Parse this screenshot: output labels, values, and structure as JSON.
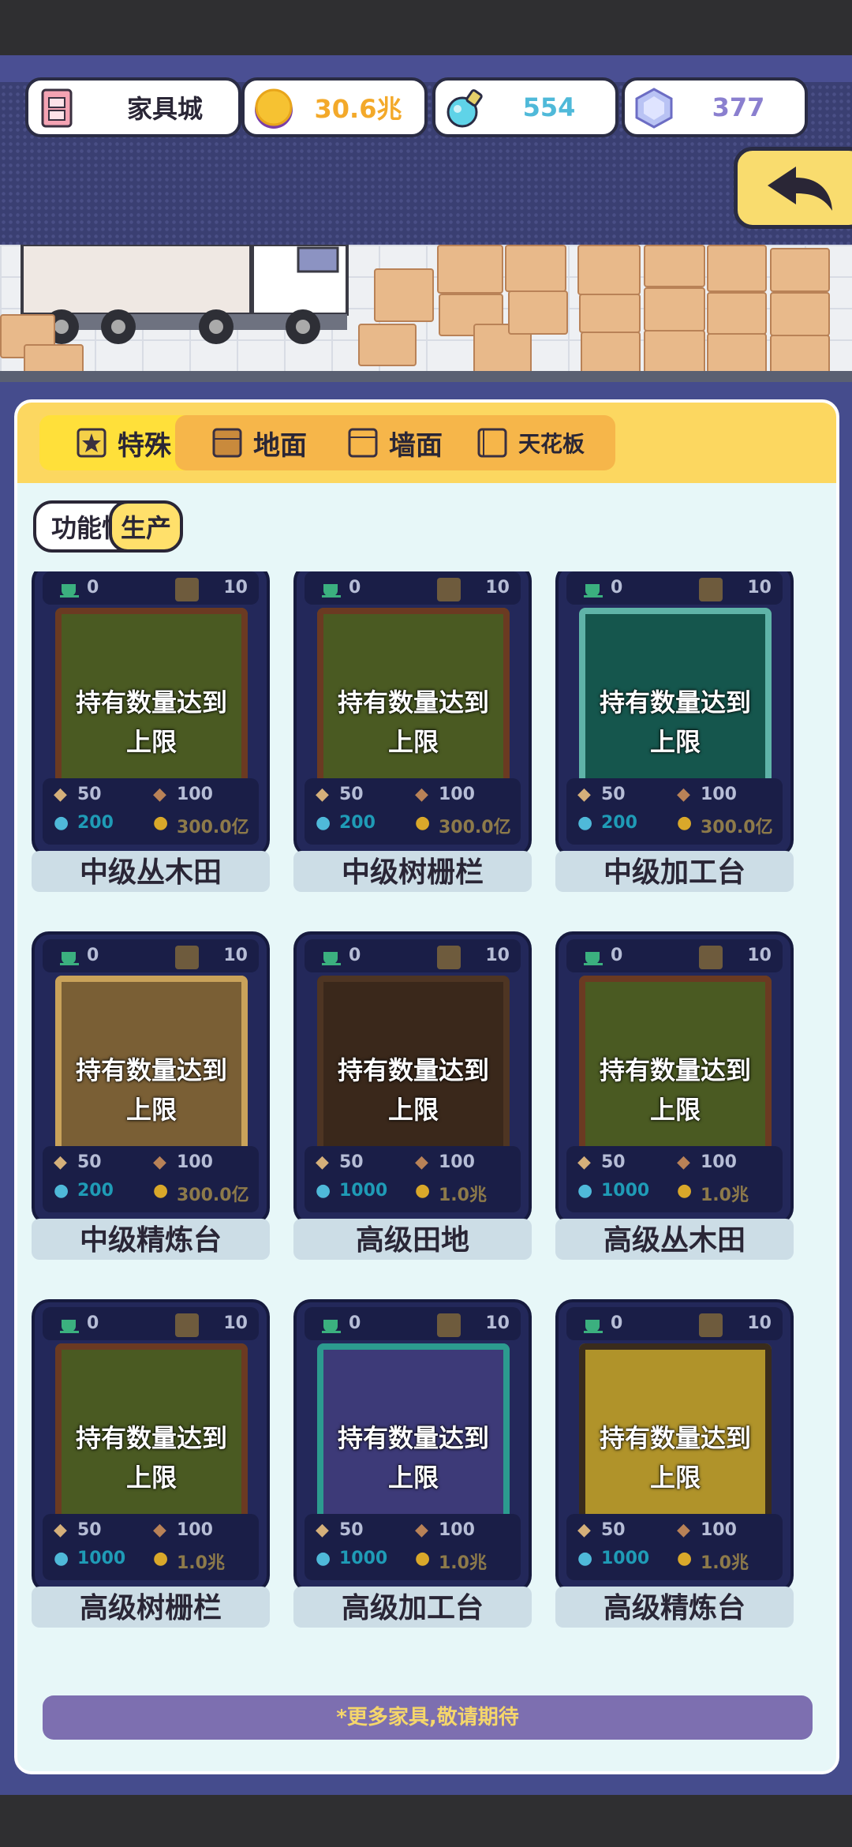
{
  "hud": {
    "location": "家具城",
    "coins": "30.6兆",
    "potion": "554",
    "gems": "377"
  },
  "tabs": [
    {
      "label": "特殊",
      "active": true
    },
    {
      "label": "地面",
      "active": false
    },
    {
      "label": "墙面",
      "active": false
    },
    {
      "label": "天花板",
      "active": false
    }
  ],
  "subtabs": [
    {
      "label": "功能性",
      "active": false
    },
    {
      "label": "生产",
      "active": true
    }
  ],
  "cards": [
    {
      "name": "中级丛木田",
      "owned": "0",
      "max": "10",
      "status": "持有数量达到上限",
      "status1": "持有数量达到",
      "status2": "上限",
      "res1": "50",
      "res2": "100",
      "potion": "200",
      "coin": "300.0亿",
      "theme": "field"
    },
    {
      "name": "中级树栅栏",
      "owned": "0",
      "max": "10",
      "status": "持有数量达到上限",
      "status1": "持有数量达到",
      "status2": "上限",
      "res1": "50",
      "res2": "100",
      "potion": "200",
      "coin": "300.0亿",
      "theme": "field"
    },
    {
      "name": "中级加工台",
      "owned": "0",
      "max": "10",
      "status": "持有数量达到上限",
      "status1": "持有数量达到",
      "status2": "上限",
      "res1": "50",
      "res2": "100",
      "potion": "200",
      "coin": "300.0亿",
      "theme": "teal"
    },
    {
      "name": "中级精炼台",
      "owned": "0",
      "max": "10",
      "status": "持有数量达到上限",
      "status1": "持有数量达到",
      "status2": "上限",
      "res1": "50",
      "res2": "100",
      "potion": "200",
      "coin": "300.0亿",
      "theme": "gold"
    },
    {
      "name": "高级田地",
      "owned": "0",
      "max": "10",
      "status": "持有数量达到上限",
      "status1": "持有数量达到",
      "status2": "上限",
      "res1": "50",
      "res2": "100",
      "potion": "1000",
      "coin": "1.0兆",
      "theme": "dirt"
    },
    {
      "name": "高级丛木田",
      "owned": "0",
      "max": "10",
      "status": "持有数量达到上限",
      "status1": "持有数量达到",
      "status2": "上限",
      "res1": "50",
      "res2": "100",
      "potion": "1000",
      "coin": "1.0兆",
      "theme": "field"
    },
    {
      "name": "高级树栅栏",
      "owned": "0",
      "max": "10",
      "status": "持有数量达到上限",
      "status1": "持有数量达到",
      "status2": "上限",
      "res1": "50",
      "res2": "100",
      "potion": "1000",
      "coin": "1.0兆",
      "theme": "field"
    },
    {
      "name": "高级加工台",
      "owned": "0",
      "max": "10",
      "status": "持有数量达到上限",
      "status1": "持有数量达到",
      "status2": "上限",
      "res1": "50",
      "res2": "100",
      "potion": "1000",
      "coin": "1.0兆",
      "theme": "purple"
    },
    {
      "name": "高级精炼台",
      "owned": "0",
      "max": "10",
      "status": "持有数量达到上限",
      "status1": "持有数量达到",
      "status2": "上限",
      "res1": "50",
      "res2": "100",
      "potion": "1000",
      "coin": "1.0兆",
      "theme": "yellow"
    }
  ],
  "footer": "*更多家具,敬请期待",
  "colors": {
    "accent": "#fcd760",
    "panel_frame": "#454c8d",
    "coin_text": "#f3a92a",
    "potion_text": "#4fb9d9",
    "gem_text": "#8a7fcf"
  }
}
